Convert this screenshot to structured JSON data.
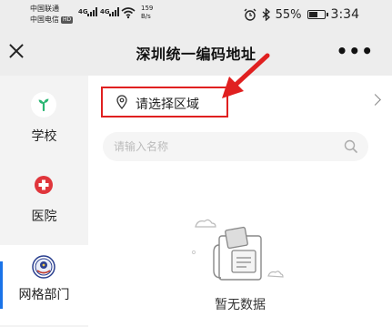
{
  "status_bar": {
    "carrier1": "中国联通",
    "carrier2": "中国电信",
    "hd_badge": "HD",
    "net1": "4G",
    "net2": "4G",
    "speed_value": "159",
    "speed_unit": "B/s",
    "battery": "55%",
    "time": "3:34"
  },
  "header": {
    "title": "深圳统一编码地址",
    "more": "•••"
  },
  "sidebar": {
    "items": [
      {
        "label": "学校",
        "icon": "sprout-icon",
        "active": false
      },
      {
        "label": "医院",
        "icon": "medical-cross-icon",
        "active": false
      },
      {
        "label": "网格部门",
        "icon": "emblem-icon",
        "active": true
      }
    ]
  },
  "main": {
    "area_selector": "请选择区域",
    "search_placeholder": "请输入名称",
    "empty_text": "暂无数据"
  },
  "colors": {
    "accent": "#1a73e8",
    "highlight": "#e02020",
    "sprout": "#2bb673",
    "cross": "#e0353b"
  }
}
